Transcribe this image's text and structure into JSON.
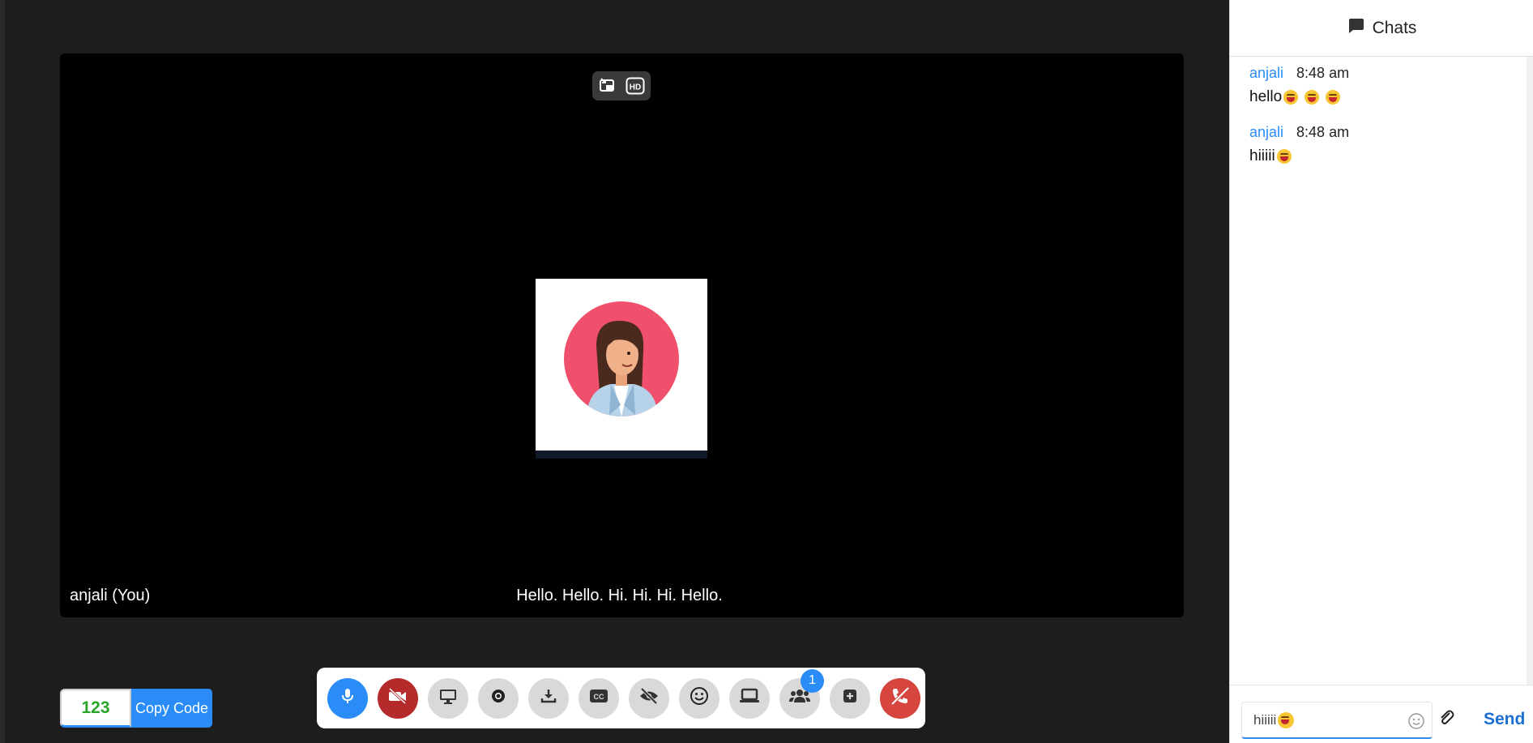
{
  "stage": {
    "participant_name": "anjali (You)",
    "caption": "Hello. Hello. Hi. Hi. Hi. Hello."
  },
  "code": {
    "value": "123",
    "copy_label": "Copy Code"
  },
  "toolbar": {
    "buttons": [
      {
        "name": "microphone",
        "icon": "microphone-icon",
        "state": "on"
      },
      {
        "name": "camera",
        "icon": "video-off-icon",
        "state": "off"
      },
      {
        "name": "screen-share",
        "icon": "monitor-icon"
      },
      {
        "name": "record",
        "icon": "record-icon"
      },
      {
        "name": "download",
        "icon": "download-icon"
      },
      {
        "name": "captions",
        "icon": "cc-icon"
      },
      {
        "name": "hide-self-view",
        "icon": "eye-slash-icon"
      },
      {
        "name": "reactions",
        "icon": "smile-icon"
      },
      {
        "name": "whiteboard",
        "icon": "laptop-icon"
      },
      {
        "name": "participants",
        "icon": "users-icon"
      },
      {
        "name": "more",
        "icon": "plus-square-icon"
      },
      {
        "name": "leave-call",
        "icon": "phone-off-icon"
      }
    ],
    "participants_count": "1"
  },
  "chat": {
    "title": "Chats",
    "messages": [
      {
        "author": "anjali",
        "time": "8:48 am",
        "text": "hello",
        "emojis": 3
      },
      {
        "author": "anjali",
        "time": "8:48 am",
        "text": "hiiiii",
        "emojis": 1
      }
    ],
    "input_value": "hiiiii",
    "send_label": "Send"
  },
  "colors": {
    "accent": "#2a8cf7",
    "danger": "#b52a2a",
    "hangup": "#d6453e",
    "stage_bg": "#1d1d1d",
    "code_text": "#2aa52a"
  }
}
